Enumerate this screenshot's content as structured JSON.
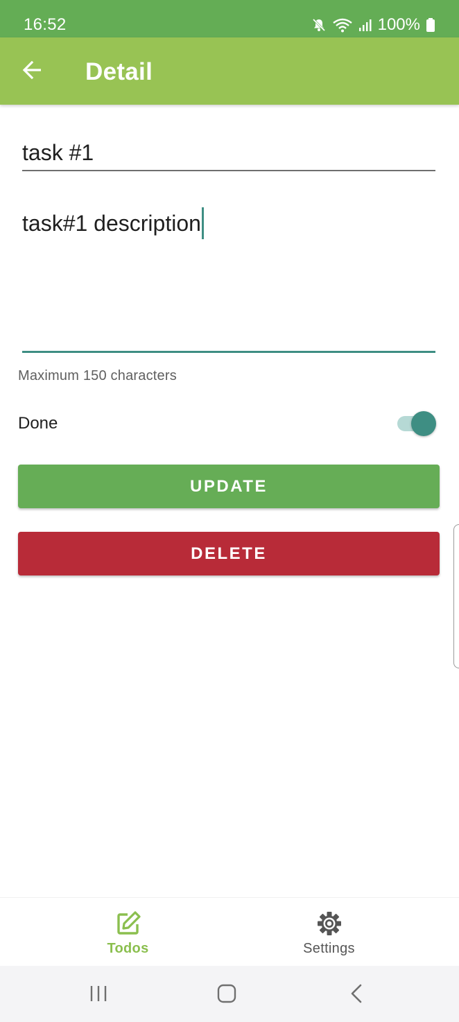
{
  "status_bar": {
    "time": "16:52",
    "battery": "100%",
    "icons": [
      "mute-icon",
      "wifi-icon",
      "signal-icon",
      "battery-icon"
    ]
  },
  "app_bar": {
    "title": "Detail",
    "back_icon": "arrow-left-icon"
  },
  "form": {
    "title_value": "task #1",
    "description_value": "task#1 description",
    "helper_text": "Maximum 150 characters",
    "done_label": "Done",
    "done_checked": true
  },
  "buttons": {
    "update_label": "UPDATE",
    "delete_label": "DELETE"
  },
  "bottom_nav": {
    "items": [
      {
        "label": "Todos",
        "icon": "edit-icon",
        "active": true
      },
      {
        "label": "Settings",
        "icon": "gear-icon",
        "active": false
      }
    ]
  },
  "system_nav": {
    "icons": [
      "recent-apps-icon",
      "home-icon",
      "back-icon"
    ]
  },
  "colors": {
    "status_bar": "#64ad55",
    "app_bar": "#98c354",
    "accent": "#3e8e83",
    "update_button": "#66ad56",
    "delete_button": "#b82b38",
    "active_nav": "#8bbf4f"
  }
}
